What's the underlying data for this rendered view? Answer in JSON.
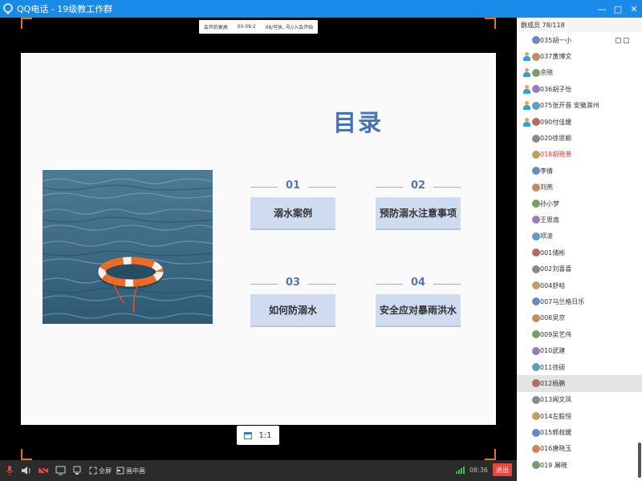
{
  "window": {
    "title": "QQ电话 - 19级教工作群",
    "controls": [
      "—",
      "□",
      "✕"
    ]
  },
  "ticker": {
    "items": [
      "会开的更高",
      "00:09:2",
      "08/可执..号//入会开始"
    ]
  },
  "slide": {
    "title": "目录",
    "items": [
      {
        "num": "01",
        "label": "溺水案例"
      },
      {
        "num": "02",
        "label": "预防溺水注意事项"
      },
      {
        "num": "03",
        "label": "如何防溺水"
      },
      {
        "num": "04",
        "label": "安全应对暴雨洪水"
      }
    ]
  },
  "zoom": {
    "label": "1:1"
  },
  "toolbar": {
    "fullscreen_label": "全屏",
    "pip_label": "画中画",
    "time": "08:36",
    "exit_label": "退出"
  },
  "panel": {
    "header": "群成员 78/118",
    "members": [
      {
        "name": "035胡一小",
        "host": false,
        "red": false,
        "hl": false
      },
      {
        "name": "037黄博文",
        "host": true,
        "red": false,
        "hl": false
      },
      {
        "name": "余晓",
        "host": true,
        "red": false,
        "hl": false
      },
      {
        "name": "036胡子怡",
        "host": true,
        "red": false,
        "hl": false
      },
      {
        "name": "075张开晋 安徽滁州",
        "host": true,
        "red": false,
        "hl": false
      },
      {
        "name": "090付佳媛",
        "host": true,
        "red": false,
        "hl": false
      },
      {
        "name": "020徐思颖",
        "host": false,
        "red": false,
        "hl": false
      },
      {
        "name": "018胡晓普",
        "host": false,
        "red": true,
        "hl": false
      },
      {
        "name": "李倩",
        "host": false,
        "red": false,
        "hl": false
      },
      {
        "name": "刘燕",
        "host": false,
        "red": false,
        "hl": false
      },
      {
        "name": "孙小梦",
        "host": false,
        "red": false,
        "hl": false
      },
      {
        "name": "王思南",
        "host": false,
        "red": false,
        "hl": false
      },
      {
        "name": "项凌",
        "host": false,
        "red": false,
        "hl": false
      },
      {
        "name": "001储彬",
        "host": false,
        "red": false,
        "hl": false
      },
      {
        "name": "002刘喜喜",
        "host": false,
        "red": false,
        "hl": false
      },
      {
        "name": "004舒晗",
        "host": false,
        "red": false,
        "hl": false
      },
      {
        "name": "007乌兰格日乐",
        "host": false,
        "red": false,
        "hl": false
      },
      {
        "name": "008吴京",
        "host": false,
        "red": false,
        "hl": false
      },
      {
        "name": "009吴艺伟",
        "host": false,
        "red": false,
        "hl": false
      },
      {
        "name": "010武建",
        "host": false,
        "red": false,
        "hl": false
      },
      {
        "name": "011徐硕",
        "host": false,
        "red": false,
        "hl": false
      },
      {
        "name": "012杨鹏",
        "host": false,
        "red": false,
        "hl": true
      },
      {
        "name": "013闻文凤",
        "host": false,
        "red": false,
        "hl": false
      },
      {
        "name": "014左毅恒",
        "host": false,
        "red": false,
        "hl": false
      },
      {
        "name": "015郭叔媛",
        "host": false,
        "red": false,
        "hl": false
      },
      {
        "name": "016唐晓玉",
        "host": false,
        "red": false,
        "hl": false
      },
      {
        "name": "019 屠晓",
        "host": false,
        "red": false,
        "hl": false
      }
    ]
  },
  "colors": {
    "titlebar": "#1a8ae8",
    "slide_title": "#4174b8",
    "toc_box": "#cfdbef",
    "frame_corner": "#e8711b",
    "exit": "#e8463c",
    "member_red": "#e8352b"
  },
  "icons": [
    "qq-call-logo-icon",
    "mic-muted-icon",
    "speaker-icon",
    "camera-off-icon",
    "share-screen-icon",
    "device-icon",
    "fullscreen-icon",
    "pip-icon",
    "signal-icon",
    "fit-window-icon",
    "host-icon",
    "avatar-icon",
    "screen-share-status-icon"
  ]
}
